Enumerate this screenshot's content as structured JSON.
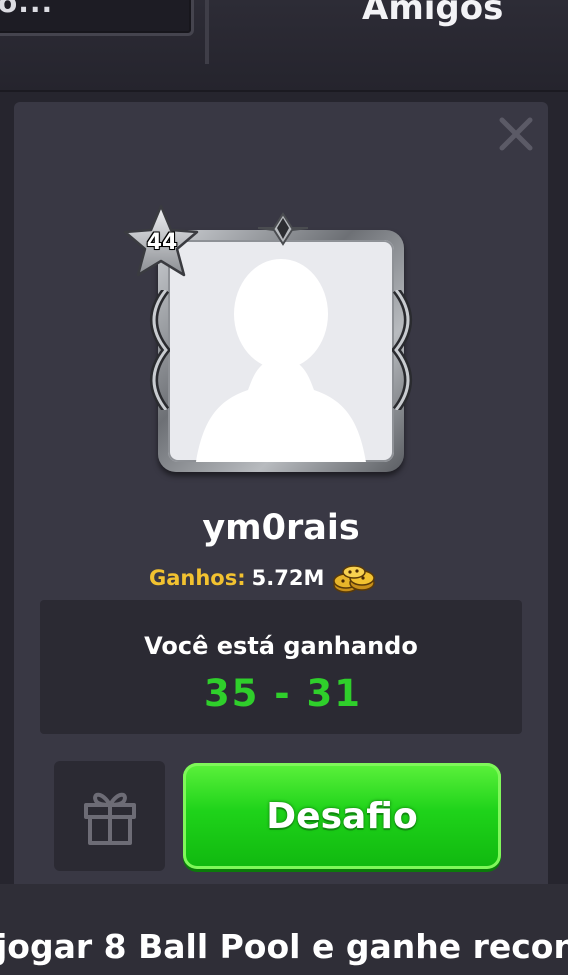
{
  "topbar": {
    "left_text": "o...",
    "title": "Amigos"
  },
  "profile": {
    "level": "44",
    "username": "ym0rais",
    "winnings_label": "Ganhos:",
    "winnings_value": "5.72M",
    "winnings_icon": "coins-icon"
  },
  "record": {
    "status": "Você está ganhando",
    "score": "35 - 31"
  },
  "actions": {
    "gift_icon": "gift-icon",
    "challenge_label": "Desafio"
  },
  "banner": {
    "text": "jogar 8 Ball Pool e ganhe recon"
  },
  "colors": {
    "accent_green": "#2fcf2b",
    "winnings_gold": "#f2c230",
    "panel_bg": "#393844"
  }
}
